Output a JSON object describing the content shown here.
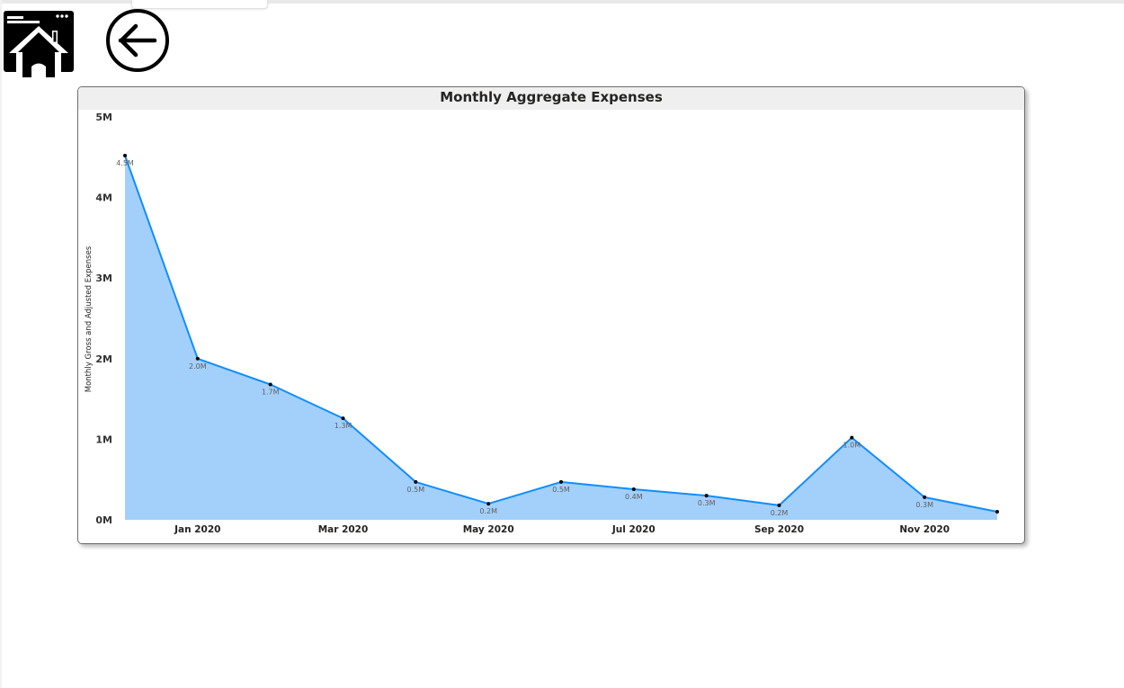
{
  "nav": {
    "home_icon": "home-icon",
    "back_icon": "arrow-left-circle-icon"
  },
  "colors": {
    "line": "#118dff",
    "area": "#a3d0fb",
    "marker": "#000000",
    "header_bg": "#efefef"
  },
  "chart_data": {
    "type": "area",
    "title": "Monthly Aggregate Expenses",
    "ylabel": "Monthly Gross and Adjusted Expenses",
    "xlabel": "",
    "ylim": [
      0,
      5000000
    ],
    "yticks": [
      {
        "value": 0,
        "label": "0M"
      },
      {
        "value": 1000000,
        "label": "1M"
      },
      {
        "value": 2000000,
        "label": "2M"
      },
      {
        "value": 3000000,
        "label": "3M"
      },
      {
        "value": 4000000,
        "label": "4M"
      },
      {
        "value": 5000000,
        "label": "5M"
      }
    ],
    "xtick_labels": [
      {
        "index": 1,
        "label": "Jan 2020"
      },
      {
        "index": 3,
        "label": "Mar 2020"
      },
      {
        "index": 5,
        "label": "May 2020"
      },
      {
        "index": 7,
        "label": "Jul 2020"
      },
      {
        "index": 9,
        "label": "Sep 2020"
      },
      {
        "index": 11,
        "label": "Nov 2020"
      }
    ],
    "points": [
      {
        "value": 4520000,
        "label": "4.5M"
      },
      {
        "value": 2000000,
        "label": "2.0M"
      },
      {
        "value": 1680000,
        "label": "1.7M"
      },
      {
        "value": 1260000,
        "label": "1.3M"
      },
      {
        "value": 470000,
        "label": "0.5M"
      },
      {
        "value": 200000,
        "label": "0.2M"
      },
      {
        "value": 470000,
        "label": "0.5M"
      },
      {
        "value": 380000,
        "label": "0.4M"
      },
      {
        "value": 300000,
        "label": "0.3M"
      },
      {
        "value": 180000,
        "label": "0.2M"
      },
      {
        "value": 1020000,
        "label": "1.0M"
      },
      {
        "value": 280000,
        "label": "0.3M"
      },
      {
        "value": 100000,
        "label": ""
      }
    ],
    "grid": false,
    "legend": "none"
  }
}
